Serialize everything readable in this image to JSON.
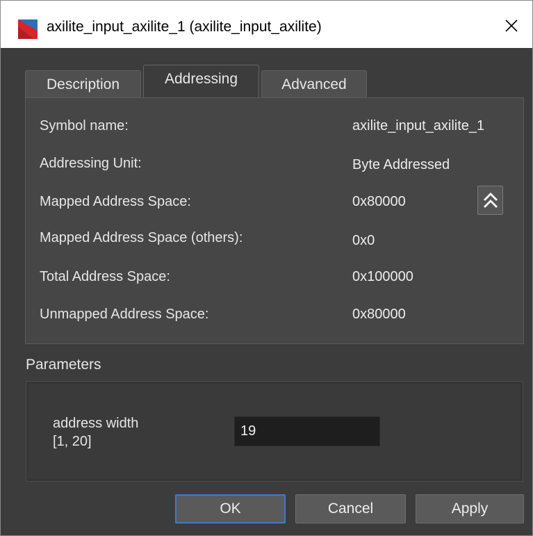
{
  "window": {
    "title": "axilite_input_axilite_1 (axilite_input_axilite)",
    "close_glyph": "✕",
    "app_icon": "vivado-logo-icon",
    "icon_colors": [
      "#d8242b",
      "#2f6fb8"
    ]
  },
  "tabs": [
    {
      "label": "Description",
      "active": false
    },
    {
      "label": "Addressing",
      "active": true
    },
    {
      "label": "Advanced",
      "active": false
    }
  ],
  "addressing": {
    "rows": [
      {
        "label": "Symbol name:",
        "value": "axilite_input_axilite_1"
      },
      {
        "label": "Addressing Unit:",
        "value": "Byte Addressed"
      },
      {
        "label": "Mapped Address Space:",
        "value": "0x80000"
      },
      {
        "label": "Mapped Address Space (others):",
        "value": "0x0"
      },
      {
        "label": "Total Address Space:",
        "value": "0x100000"
      },
      {
        "label": "Unmapped Address Space:",
        "value": "0x80000"
      }
    ],
    "collapse_icon": "double-chevron-up-icon"
  },
  "parameters": {
    "heading": "Parameters",
    "address_width_label": "address width",
    "address_width_range": "[1, 20]",
    "address_width_value": "19"
  },
  "buttons": {
    "ok": "OK",
    "cancel": "Cancel",
    "apply": "Apply"
  },
  "colors": {
    "background": "#3c3c3c",
    "panel": "#464646",
    "focus_border": "#3d7cc9"
  }
}
